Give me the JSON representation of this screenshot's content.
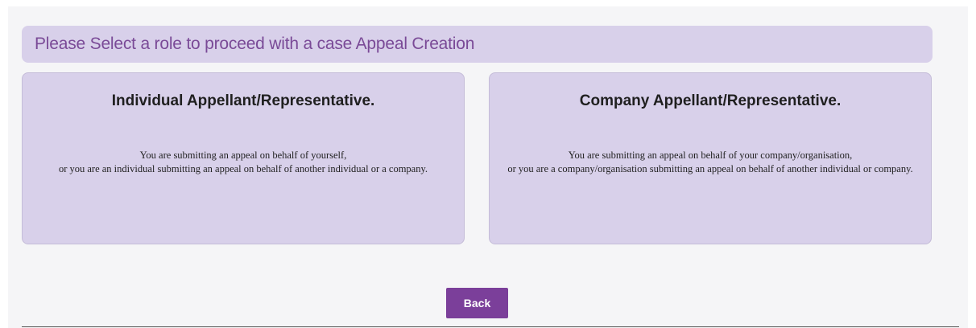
{
  "header": {
    "title": "Please Select a role to proceed with a case Appeal Creation"
  },
  "cards": [
    {
      "title": "Individual Appellant/Representative.",
      "description_lines": [
        "You are submitting an appeal on behalf of yourself,",
        "or you are an individual submitting an appeal on behalf of another individual or a company."
      ]
    },
    {
      "title": "Company Appellant/Representative.",
      "description_lines": [
        "You are submitting an appeal on behalf of your company/organisation,",
        "or you are a company/organisation submitting an appeal on behalf of another individual or company."
      ]
    }
  ],
  "actions": {
    "back_label": "Back"
  },
  "colors": {
    "panel_background": "#d8d0ea",
    "title_text": "#7a4a97",
    "button_background": "#7b3f9a"
  }
}
